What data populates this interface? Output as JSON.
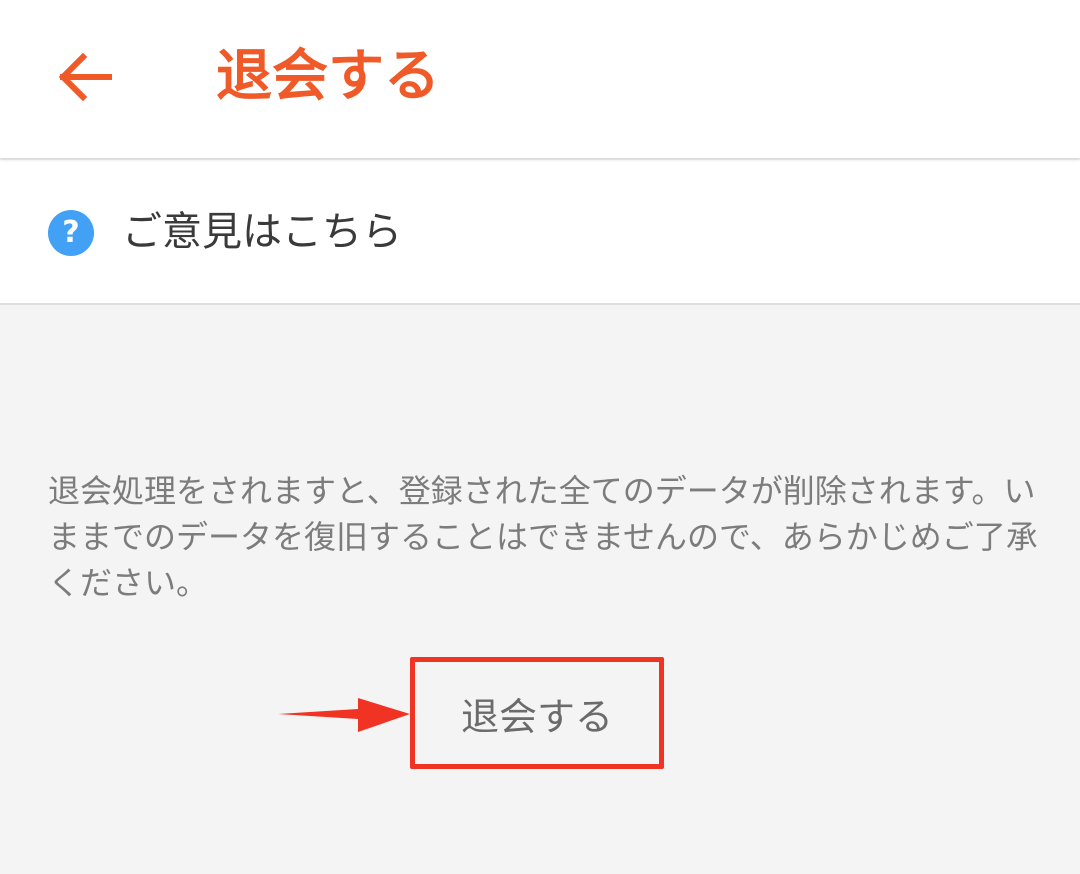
{
  "header": {
    "back_icon": "arrow-left-icon",
    "title": "退会する",
    "accent_color": "#f05a28"
  },
  "feedback": {
    "icon": "question-circle-icon",
    "icon_glyph": "?",
    "icon_color": "#42a0f5",
    "label": "ご意見はこちら"
  },
  "notice": {
    "text": "退会処理をされますと、登録された全てのデータが削除されます。いままでのデータを復旧することはできませんので、あらかじめご了承ください。"
  },
  "withdraw": {
    "button_label": "退会する",
    "highlight_color": "#f03323",
    "pointer_icon": "red-pointer-arrow-icon"
  }
}
